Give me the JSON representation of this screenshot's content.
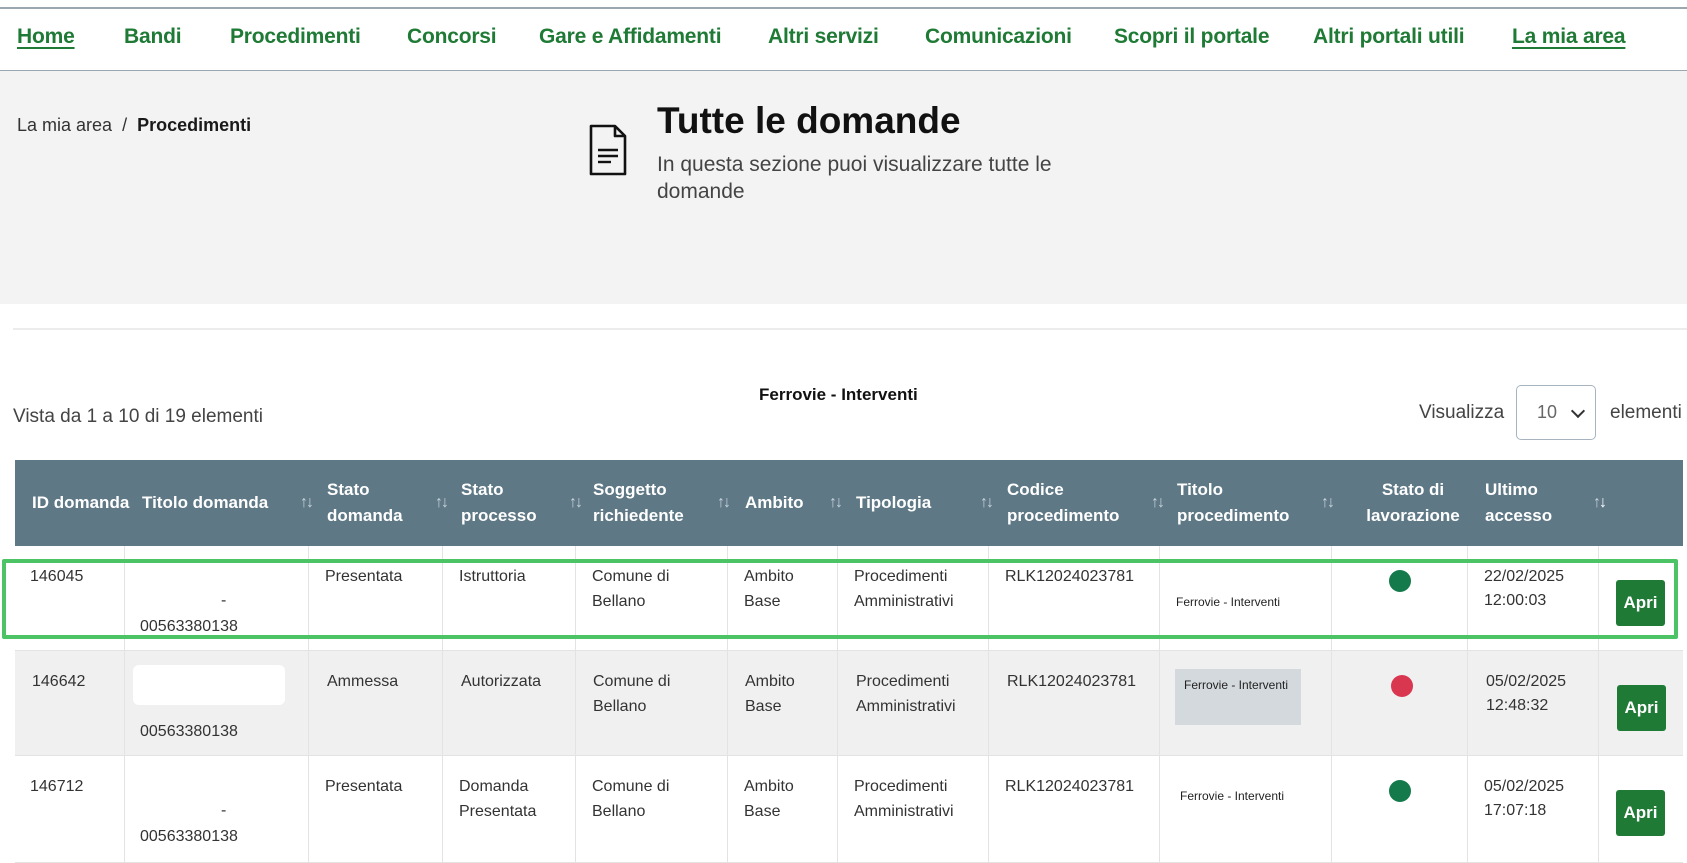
{
  "nav": {
    "items": [
      {
        "label": "Home"
      },
      {
        "label": "Bandi"
      },
      {
        "label": "Procedimenti"
      },
      {
        "label": "Concorsi"
      },
      {
        "label": "Gare e Affidamenti"
      },
      {
        "label": "Altri servizi"
      },
      {
        "label": "Comunicazioni"
      },
      {
        "label": "Scopri il portale"
      },
      {
        "label": "Altri portali utili"
      },
      {
        "label": "La mia area"
      }
    ]
  },
  "breadcrumb": {
    "parent": "La mia area",
    "separator": "/",
    "current": "Procedimenti"
  },
  "header": {
    "icon": "document-icon",
    "title": "Tutte le domande",
    "subtitle": "In questa sezione puoi visualizzare tutte le domande"
  },
  "list": {
    "count_text": "Vista da 1 a 10 di 19 elementi",
    "filter_label": "Ferrovie - Interventi",
    "show_label": "Visualizza",
    "page_size": "10",
    "show_after": "elementi"
  },
  "table": {
    "columns": [
      {
        "label": "ID domanda"
      },
      {
        "label": "Titolo domanda"
      },
      {
        "label": "Stato domanda"
      },
      {
        "label": "Stato processo"
      },
      {
        "label": "Soggetto richiedente"
      },
      {
        "label": "Ambito"
      },
      {
        "label": "Tipologia"
      },
      {
        "label": "Codice procedimento"
      },
      {
        "label": "Titolo procedimento"
      },
      {
        "label": "Stato di lavorazione"
      },
      {
        "label": "Ultimo accesso"
      }
    ],
    "rows": [
      {
        "id": "146045",
        "titolo_dash": "-",
        "titolo_code": "00563380138",
        "stato_domanda": "Presentata",
        "stato_processo": "Istruttoria",
        "soggetto": "Comune di Bellano",
        "ambito": "Ambito Base",
        "tipologia": "Procedimenti Amministrativi",
        "codice": "RLK12024023781",
        "titolo_proc": "Ferrovie - Interventi",
        "status_color": "#147a4c",
        "data": "22/02/2025",
        "ora": "12:00:03",
        "action": "Apri"
      },
      {
        "id": "146642",
        "titolo_dash": "",
        "titolo_code": "00563380138",
        "stato_domanda": "Ammessa",
        "stato_processo": "Autorizzata",
        "soggetto": "Comune di Bellano",
        "ambito": "Ambito Base",
        "tipologia": "Procedimenti Amministrativi",
        "codice": "RLK12024023781",
        "titolo_proc": "Ferrovie - Interventi",
        "status_color": "#d9364f",
        "data": "05/02/2025",
        "ora": "12:48:32",
        "action": "Apri"
      },
      {
        "id": "146712",
        "titolo_dash": "-",
        "titolo_code": "00563380138",
        "stato_domanda": "Presentata",
        "stato_processo": "Domanda Presentata",
        "soggetto": "Comune di Bellano",
        "ambito": "Ambito Base",
        "tipologia": "Procedimenti Amministrativi",
        "codice": "RLK12024023781",
        "titolo_proc": "Ferrovie - Interventi",
        "status_color": "#147a4c",
        "data": "05/02/2025",
        "ora": "17:07:18",
        "action": "Apri"
      }
    ]
  },
  "colors": {
    "brand_green": "#1f7a35",
    "header_bg": "#5e7886",
    "highlight": "#4cc466"
  }
}
